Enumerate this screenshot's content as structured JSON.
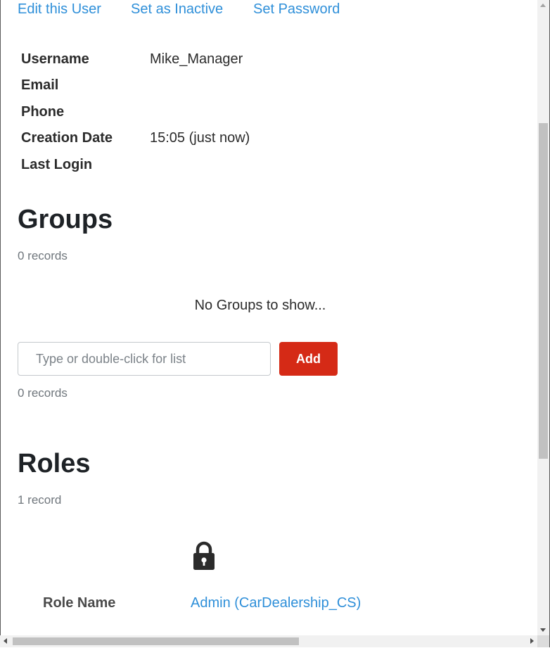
{
  "actions": {
    "edit": "Edit this User",
    "inactive": "Set as Inactive",
    "password": "Set Password"
  },
  "properties": [
    {
      "label": "Username",
      "value": "Mike_Manager"
    },
    {
      "label": "Email",
      "value": ""
    },
    {
      "label": "Phone",
      "value": ""
    },
    {
      "label": "Creation Date",
      "value": "15:05 (just now)"
    },
    {
      "label": "Last Login",
      "value": ""
    }
  ],
  "groups": {
    "title": "Groups",
    "count": "0 records",
    "empty_message": "No Groups to show...",
    "input_placeholder": "Type or double-click for list",
    "add_label": "Add",
    "footer_count": "0 records"
  },
  "roles": {
    "title": "Roles",
    "count": "1 record",
    "rows": [
      {
        "label": "Role Name",
        "value": "Admin (CarDealership_CS)",
        "icon": "lock-icon"
      }
    ]
  },
  "colors": {
    "link": "#2e8fd9",
    "accent_button": "#d52a16"
  }
}
